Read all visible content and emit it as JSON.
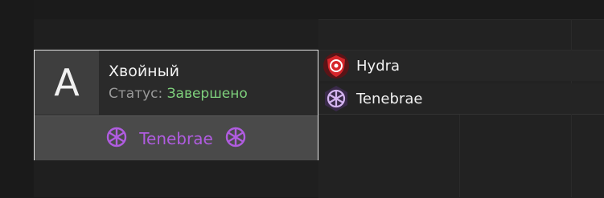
{
  "match": {
    "avatar_letter": "A",
    "team_name": "Хвойный",
    "status_label": "Статус: ",
    "status_value": "Завершено",
    "winner": {
      "name": "Tenebrae",
      "icon": "tenebrae-emblem-icon"
    }
  },
  "teams": [
    {
      "name": "Hydra",
      "icon": "hydra-shield-icon"
    },
    {
      "name": "Tenebrae",
      "icon": "tenebrae-emblem-icon"
    }
  ],
  "colors": {
    "status_done": "#7ed07c",
    "winner": "#b05ce0",
    "hydra_red": "#d6262b",
    "tenebrae_purple": "#b05ce0"
  }
}
